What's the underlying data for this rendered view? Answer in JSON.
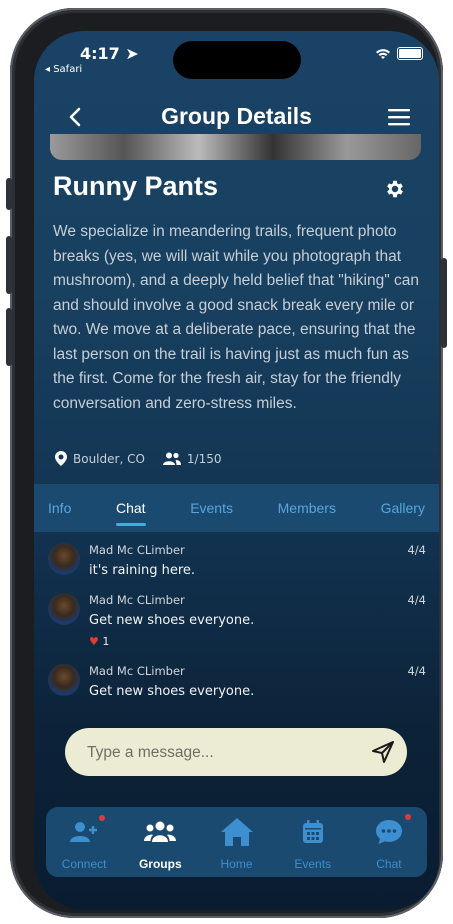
{
  "status_bar": {
    "time": "4:17",
    "back_app": "◂ Safari"
  },
  "header": {
    "title": "Group Details"
  },
  "group": {
    "name": "Runny Pants",
    "description": "We specialize in meandering trails, frequent photo breaks (yes, we will wait while you photograph that mushroom), and a deeply held belief that \"hiking\" can and should involve a good snack break every mile or two. We move at a deliberate pace, ensuring that the last person on the trail is having just as much fun as the first. Come for the fresh air, stay for the friendly conversation and zero-stress miles.",
    "location": "Boulder, CO",
    "members_count": "1/150"
  },
  "tabs": [
    {
      "label": "Info",
      "active": false
    },
    {
      "label": "Chat",
      "active": true
    },
    {
      "label": "Events",
      "active": false
    },
    {
      "label": "Members",
      "active": false
    },
    {
      "label": "Gallery",
      "active": false
    }
  ],
  "messages": [
    {
      "author": "Mad Mc CLimber",
      "date": "4/4",
      "text": "it's raining here.",
      "reaction": null
    },
    {
      "author": "Mad Mc CLimber",
      "date": "4/4",
      "text": "Get new shoes everyone.",
      "reaction": {
        "icon": "heart-icon",
        "count": "1"
      }
    },
    {
      "author": "Mad Mc CLimber",
      "date": "4/4",
      "text": "Get new shoes everyone.",
      "reaction": null
    }
  ],
  "composer": {
    "placeholder": "Type a message..."
  },
  "bottom_nav": [
    {
      "label": "Connect",
      "icon": "add-person-icon",
      "badge": true,
      "active": false
    },
    {
      "label": "Groups",
      "icon": "groups-icon",
      "badge": false,
      "active": true
    },
    {
      "label": "Home",
      "icon": "home-icon",
      "badge": false,
      "active": false
    },
    {
      "label": "Events",
      "icon": "calendar-icon",
      "badge": false,
      "active": false
    },
    {
      "label": "Chat",
      "icon": "chat-bubble-icon",
      "badge": true,
      "active": false
    }
  ],
  "colors": {
    "accent": "#3bb3d9",
    "nav_inactive": "#3d8fcf",
    "badge": "#e53935",
    "composer_bg": "#ecebd3"
  }
}
